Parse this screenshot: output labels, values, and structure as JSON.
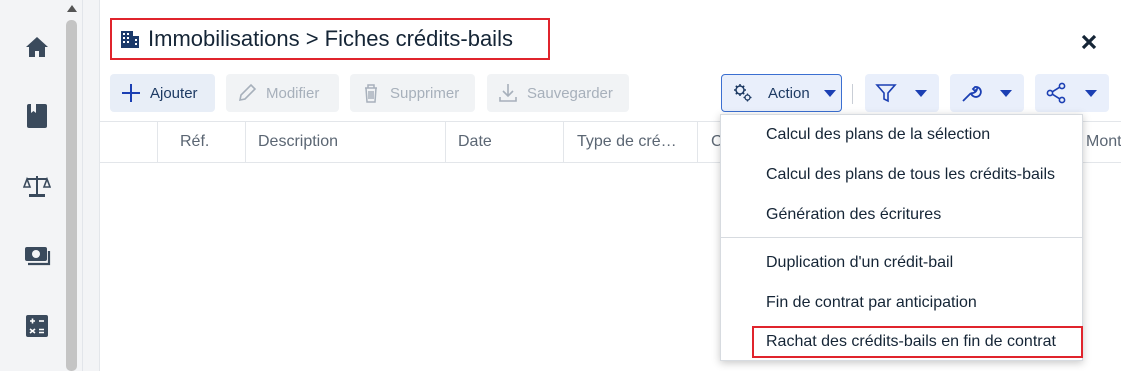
{
  "title": {
    "text": "Immobilisations > Fiches crédits-bails",
    "icon": "building-icon"
  },
  "sidebar": {
    "items": [
      {
        "name": "home",
        "icon": "home-icon"
      },
      {
        "name": "book",
        "icon": "book-icon"
      },
      {
        "name": "balance",
        "icon": "scale-icon"
      },
      {
        "name": "money",
        "icon": "banknote-icon"
      },
      {
        "name": "calculator",
        "icon": "calculator-icon"
      }
    ]
  },
  "toolbar": {
    "add_label": "Ajouter",
    "modify_label": "Modifier",
    "delete_label": "Supprimer",
    "save_label": "Sauvegarder",
    "action_label": "Action"
  },
  "table": {
    "columns": [
      "",
      "Réf.",
      "Description",
      "Date",
      "Type de cré…",
      "C",
      "",
      "Mont"
    ]
  },
  "action_menu": {
    "items": [
      "Calcul des plans de la sélection",
      "Calcul des plans de tous les crédits-bails",
      "Génération des écritures",
      "Duplication d'un crédit-bail",
      "Fin de contrat par anticipation",
      "Rachat des crédits-bails en fin de contrat"
    ]
  },
  "colors": {
    "accent": "#1b3fb3",
    "highlight": "#e0242c",
    "title_text": "#152536",
    "disabled_text": "#a7b0bb"
  }
}
